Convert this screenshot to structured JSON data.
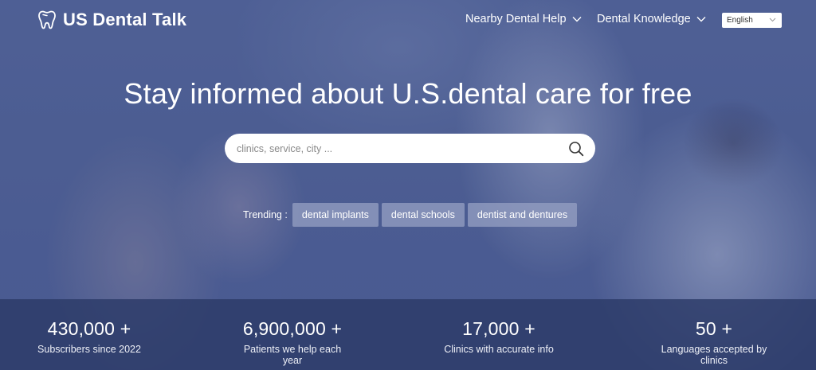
{
  "brand": {
    "name": "US Dental Talk",
    "icon": "tooth-icon"
  },
  "nav": {
    "items": [
      {
        "label": "Nearby Dental Help",
        "icon": "chevron-down-icon"
      },
      {
        "label": "Dental Knowledge",
        "icon": "chevron-down-icon"
      }
    ],
    "language": {
      "selected": "English",
      "icon": "chevron-down-icon"
    }
  },
  "hero": {
    "headline": "Stay informed about U.S.dental care for free",
    "search": {
      "placeholder": "clinics, service, city ...",
      "value": "",
      "icon": "search-icon"
    },
    "trending": {
      "label": "Trending :",
      "tags": [
        "dental implants",
        "dental schools",
        "dentist and dentures"
      ]
    }
  },
  "stats": [
    {
      "value": "430,000 +",
      "label": "Subscribers since 2022"
    },
    {
      "value": "6,900,000 +",
      "label": "Patients we help each year"
    },
    {
      "value": "17,000 +",
      "label": "Clinics with accurate info"
    },
    {
      "value": "50 +",
      "label": "Languages accepted by clinics"
    }
  ],
  "colors": {
    "overlay": "#3a4a82",
    "stats_bar": "#2c3a68",
    "text": "#ffffff"
  }
}
